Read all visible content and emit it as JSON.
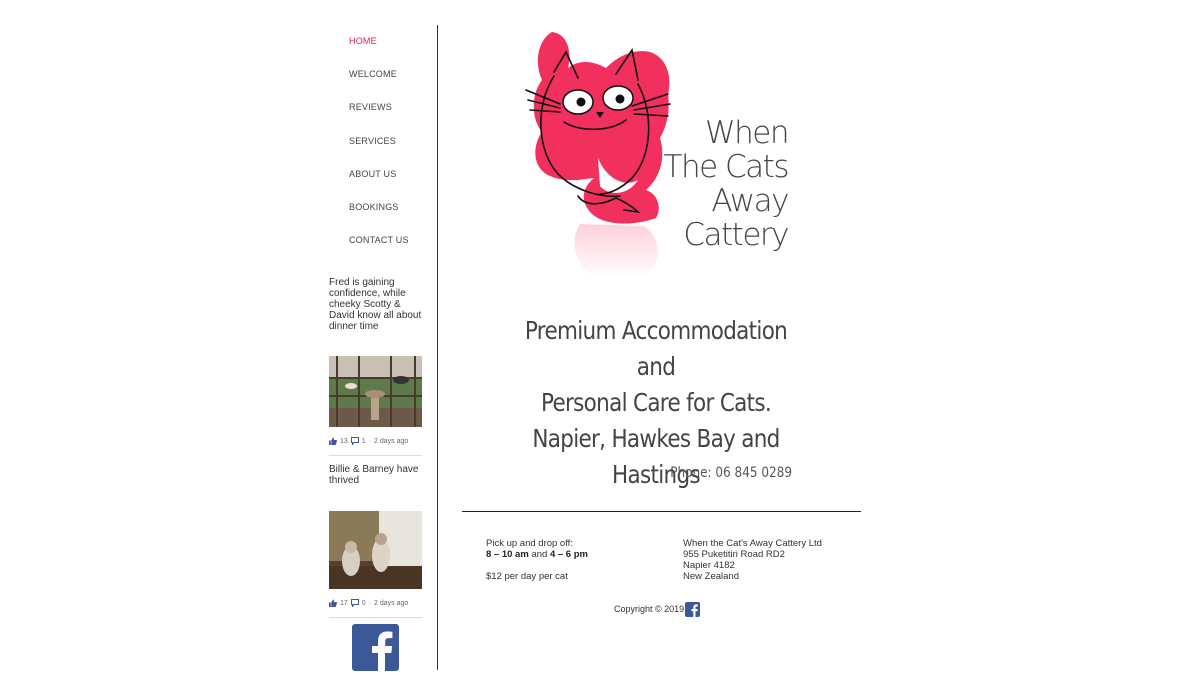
{
  "nav": {
    "items": [
      "HOME",
      "WELCOME",
      "REVIEWS",
      "SERVICES",
      "ABOUT US",
      "BOOKINGS",
      "CONTACT US"
    ]
  },
  "feed": [
    {
      "text": "Fred is gaining confidence, while cheeky Scotty & David know all about dinner time",
      "likes": "13",
      "comments": "1",
      "time": "2 days ago"
    },
    {
      "text": "Billie & Barney have thrived",
      "likes": "17",
      "comments": "0",
      "time": "2 days ago"
    }
  ],
  "logo": {
    "lines": [
      "When",
      "The Cats",
      "Away",
      "Cattery"
    ]
  },
  "tagline": [
    "Premium Accommodation and",
    "Personal Care for Cats.",
    "Napier, Hawkes Bay and",
    "Hastings"
  ],
  "phone": "Phone: 06 845 0289",
  "footer": {
    "pickup_label": "Pick up and drop off:",
    "pickup_time_1": "8 – 10 am",
    "pickup_and": "and",
    "pickup_time_2": "4 – 6 pm",
    "price": "$12 per day per cat",
    "address": [
      "When the Cat's Away Cattery Ltd",
      "955 Puketitiri Road RD2",
      "Napier 4182",
      "New Zealand"
    ],
    "copyright": "Copyright © 2019"
  },
  "colors": {
    "accent": "#d81b60",
    "logo_pink": "#f2305e",
    "facebook": "#3b5998"
  },
  "icons": [
    "thumbs-up-icon",
    "comment-icon",
    "facebook-icon"
  ]
}
